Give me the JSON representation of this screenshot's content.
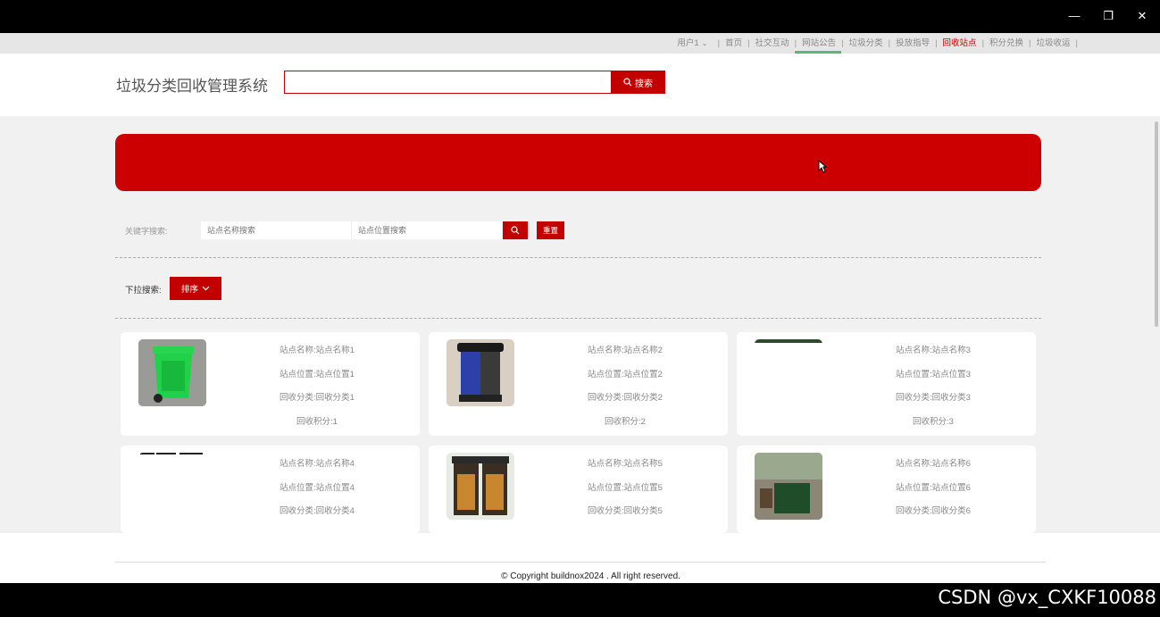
{
  "nav": {
    "user": "用户1",
    "items": [
      "首页",
      "社交互动",
      "网站公告",
      "垃圾分类",
      "投放指导",
      "回收站点",
      "积分兑换",
      "垃圾收运"
    ]
  },
  "header": {
    "brand": "垃圾分类回收管理系统",
    "search_placeholder": "",
    "search_button": "搜索"
  },
  "filter": {
    "keyword_label": "关键字搜索:",
    "name_placeholder": "站点名称搜索",
    "location_placeholder": "站点位置搜索",
    "reset_button": "重置",
    "dropdown_label": "下拉搜索:",
    "sort_button": "排序"
  },
  "cards": [
    {
      "name": "站点名称:站点名称1",
      "location": "站点位置:站点位置1",
      "category": "回收分类:回收分类1",
      "points": "回收积分:1"
    },
    {
      "name": "站点名称:站点名称2",
      "location": "站点位置:站点位置2",
      "category": "回收分类:回收分类2",
      "points": "回收积分:2"
    },
    {
      "name": "站点名称:站点名称3",
      "location": "站点位置:站点位置3",
      "category": "回收分类:回收分类3",
      "points": "回收积分:3"
    },
    {
      "name": "站点名称:站点名称4",
      "location": "站点位置:站点位置4",
      "category": "回收分类:回收分类4"
    },
    {
      "name": "站点名称:站点名称5",
      "location": "站点位置:站点位置5",
      "category": "回收分类:回收分类5"
    },
    {
      "name": "站点名称:站点名称6",
      "location": "站点位置:站点位置6",
      "category": "回收分类:回收分类6"
    }
  ],
  "footer": {
    "copyright": "© Copyright buildnox2024 . All right reserved."
  },
  "watermark": "CSDN @vx_CXKF10088",
  "colors": {
    "accent": "#c30000",
    "banner": "#cc0000",
    "nav_underline": "#5bb87a"
  },
  "icons": [
    "minimize-icon",
    "maximize-icon",
    "close-icon",
    "search-icon",
    "chevron-down-icon",
    "mouse-cursor-icon"
  ]
}
